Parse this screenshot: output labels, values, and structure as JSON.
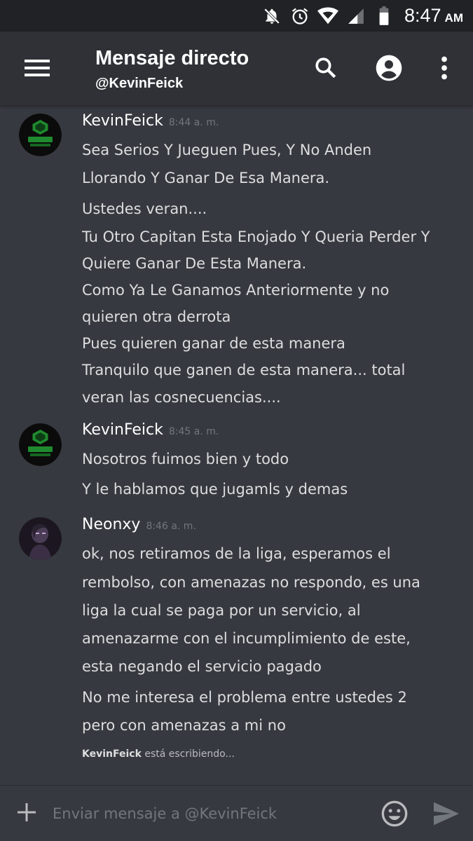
{
  "status_bar": {
    "time": "8:47",
    "ampm": "AM"
  },
  "header": {
    "title": "Mensaje directo",
    "subtitle": "@KevinFeick"
  },
  "messages": [
    {
      "author": "KevinFeick",
      "time": "8:44 a. m.",
      "avatar": "kevinfeick-avatar",
      "lines": [
        "Sea Serios Y Jueguen Pues, Y No Anden",
        "Llorando Y Ganar De Esa Manera.",
        "Ustedes veran....",
        "Tu Otro Capitan Esta Enojado Y Queria Perder Y",
        "Quiere Ganar De Esta Manera.",
        "Como Ya Le Ganamos Anteriormente y no",
        "quieren otra derrota",
        "Pues quieren ganar de esta manera",
        "Tranquilo que ganen de esta manera... total",
        "veran las cosnecuencias...."
      ]
    },
    {
      "author": "KevinFeick",
      "time": "8:45 a. m.",
      "avatar": "kevinfeick-avatar",
      "lines": [
        "Nosotros fuimos bien y todo",
        "Y le hablamos que jugamls y demas"
      ]
    },
    {
      "author": "Neonxy",
      "time": "8:46 a. m.",
      "avatar": "neonxy-avatar",
      "lines": [
        "ok, nos retiramos de la liga, esperamos el",
        "rembolso, con amenazas no respondo, es una",
        "liga la cual se paga por un servicio, al",
        "amenazarme con el incumplimiento de este,",
        "esta negando el servicio pagado",
        "No me interesa el problema entre ustedes 2",
        "pero con amenazas a mi no"
      ]
    }
  ],
  "typing": {
    "user": "KevinFeick",
    "text": "está escribiendo..."
  },
  "composer": {
    "placeholder": "Enviar mensaje a @KevinFeick"
  },
  "colors": {
    "background": "#36393f",
    "header": "#2f3136",
    "status_bar": "#202225",
    "text": "#dcddde",
    "muted": "#72767d"
  },
  "icons": [
    "notifications-off-icon",
    "alarm-icon",
    "wifi-icon",
    "signal-icon",
    "battery-icon",
    "hamburger-menu-icon",
    "search-icon",
    "account-icon",
    "more-vert-icon",
    "plus-icon",
    "emoji-icon",
    "send-icon"
  ]
}
